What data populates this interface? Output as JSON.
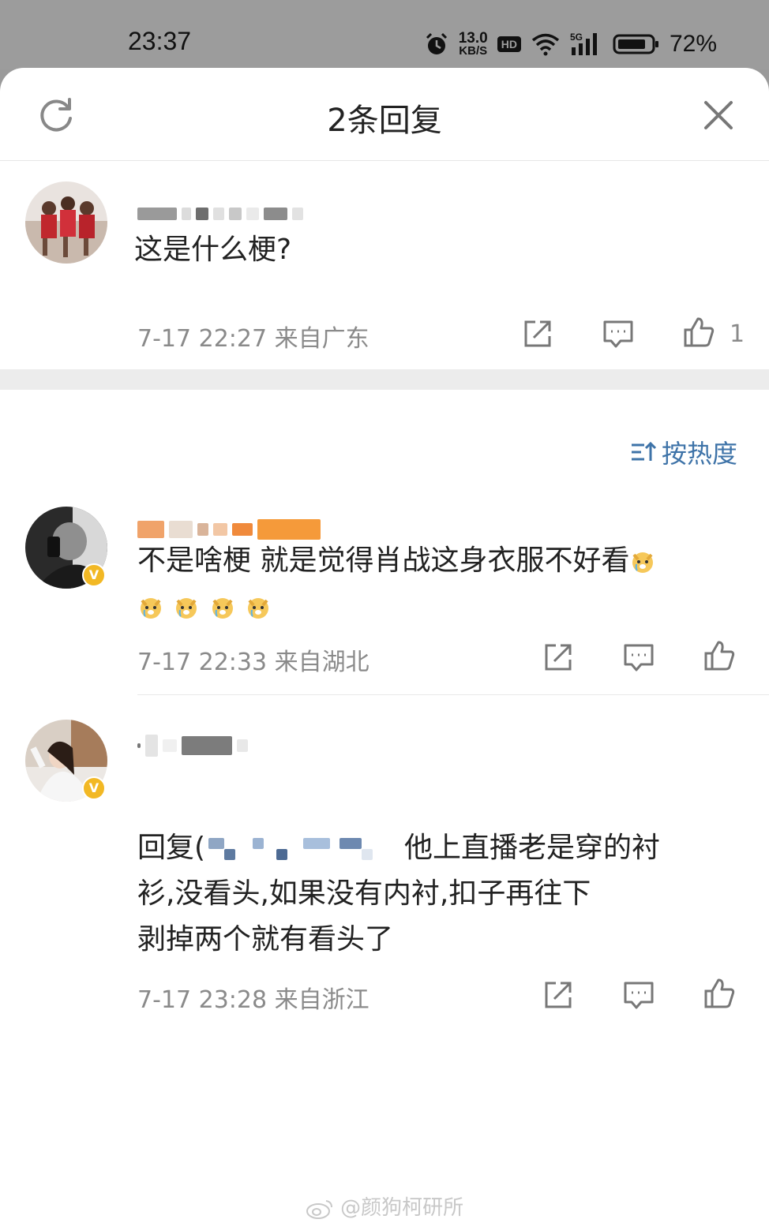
{
  "status_bar": {
    "time": "23:37",
    "speed_value": "13.0",
    "speed_unit": "KB/S",
    "hd": "HD",
    "network": "5G",
    "battery": "72%",
    "icons": [
      "alarm-icon",
      "wifi-icon",
      "signal-icon",
      "battery-icon"
    ]
  },
  "header": {
    "title": "2条回复",
    "refresh_icon": "refresh-icon",
    "close_icon": "close-icon"
  },
  "root_comment": {
    "text": "这是什么梗?",
    "meta": "7-17 22:27  来自广东",
    "like_count": "1"
  },
  "sort": {
    "label": "按热度",
    "icon": "sort-icon"
  },
  "replies": [
    {
      "text_line1": "不是啥梗 就是觉得肖战这身衣服不好看",
      "meta": "7-17 22:33  来自湖北",
      "verified": true
    },
    {
      "reply_prefix": "回复(",
      "text_after_mention": "他上直播老是穿的衬",
      "text_line2": "衫,没看头,如果没有内衬,扣子再往下",
      "text_line3": "剥掉两个就有看头了",
      "meta": "7-17 23:28  来自浙江",
      "verified": true
    }
  ],
  "badge_letter": "V",
  "watermark": "@颜狗柯研所",
  "colors": {
    "link": "#3e73a8",
    "meta": "#8a8a8a",
    "badge": "#f2b824",
    "divider": "#ececec"
  }
}
